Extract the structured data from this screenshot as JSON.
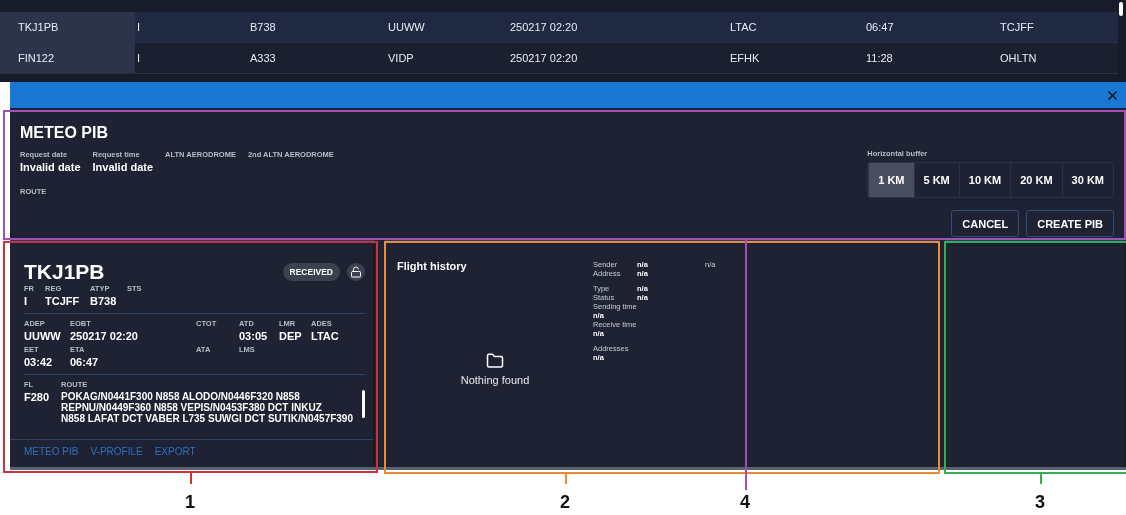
{
  "table": {
    "rows": [
      {
        "selected": true,
        "cells": [
          "TKJ1PB",
          "I",
          "B738",
          "UUWW",
          "250217 02:20",
          "LTAC",
          "06:47",
          "TCJFF"
        ]
      },
      {
        "selected": false,
        "cells": [
          "FIN122",
          "I",
          "A333",
          "VIDP",
          "250217 02:20",
          "EFHK",
          "11:28",
          "OHLTN"
        ]
      }
    ]
  },
  "meteo_pib": {
    "title": "METEO PIB",
    "fields": [
      {
        "label": "Request date",
        "value": "Invalid date"
      },
      {
        "label": "Request time",
        "value": "Invalid date"
      },
      {
        "label": "ALTN AERODROME"
      },
      {
        "label": "2nd ALTN AERODROME"
      }
    ],
    "route_label": "ROUTE",
    "buffer_label": "Horizontal buffer",
    "buffer_options": [
      {
        "label": "1 KM",
        "selected": true
      },
      {
        "label": "5 KM",
        "selected": false
      },
      {
        "label": "10 KM",
        "selected": false
      },
      {
        "label": "20 KM",
        "selected": false
      },
      {
        "label": "30 KM",
        "selected": false
      }
    ],
    "buttons": [
      "CANCEL",
      "CREATE PIB"
    ]
  },
  "flight_card": {
    "callsign": "TKJ1PB",
    "status": "RECEIVED",
    "ident": [
      {
        "label": "FR",
        "value": "I"
      },
      {
        "label": "REG",
        "value": "TCJFF"
      },
      {
        "label": "ATYP",
        "value": "B738"
      },
      {
        "label": "STS"
      }
    ],
    "times": [
      {
        "label": "ADEP",
        "value": "UUWW"
      },
      {
        "label": "EOBT",
        "value": "250217 02:20"
      },
      {
        "label": "CTOT"
      },
      {
        "label": "ATD",
        "value": "03:05"
      },
      {
        "label": "LMR",
        "value": "DEP"
      },
      {
        "label": "ADES",
        "value": "LTAC"
      },
      {
        "label": "EET",
        "value": "03:42"
      },
      {
        "label": "ETA",
        "value": "06:47"
      },
      {
        "label": "ATA"
      },
      {
        "label": "LMS"
      }
    ],
    "fl_label": "FL",
    "fl": "F280",
    "route_label": "ROUTE",
    "route_lines": [
      "POKAG/N0441F300 N858 ALODO/N0446F320 N858",
      "REPNU/N0449F360 N858 VEPIS/N0453F380 DCT INKUZ",
      "N858 LAFAT DCT VABER L735 SUWGI DCT SUTIK/N0457F390"
    ],
    "links": [
      "METEO PIB",
      "V-PROFILE",
      "EXPORT"
    ]
  },
  "flight_history": {
    "title": "Flight history",
    "empty_text": "Nothing found",
    "extra": "n/a",
    "groups": [
      [
        {
          "kind": "inline",
          "label": "Sender",
          "value": "n/a"
        },
        {
          "kind": "inline",
          "label": "Address",
          "value": "n/a"
        }
      ],
      [
        {
          "kind": "inline",
          "label": "Type",
          "value": "n/a"
        },
        {
          "kind": "inline",
          "label": "Status",
          "value": "n/a"
        },
        {
          "kind": "stacked",
          "label": "Sending time",
          "value": "n/a"
        },
        {
          "kind": "stacked",
          "label": "Receive time",
          "value": "n/a"
        }
      ],
      [
        {
          "kind": "stacked",
          "label": "Addresses",
          "value": "n/a"
        }
      ]
    ]
  },
  "annotations": [
    {
      "number": "1",
      "color": "#d0303a"
    },
    {
      "number": "2",
      "color": "#f08a30"
    },
    {
      "number": "4",
      "color": "#a050b8"
    },
    {
      "number": "3",
      "color": "#30b050"
    }
  ]
}
